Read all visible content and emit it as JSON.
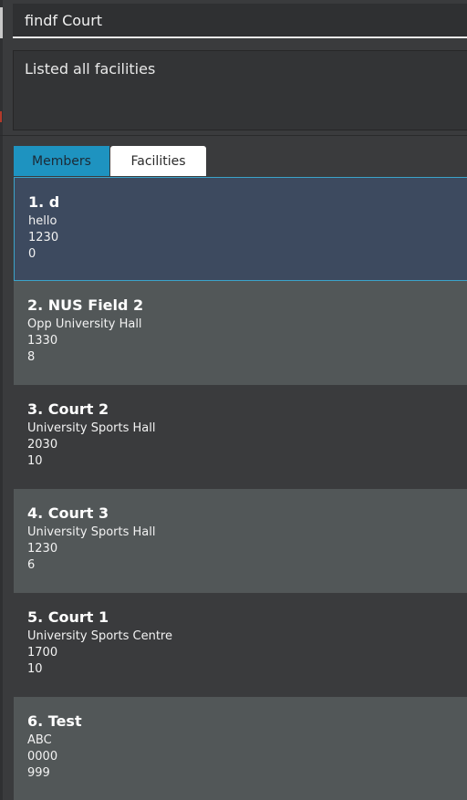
{
  "command": {
    "value": "findf Court"
  },
  "result": {
    "message": "Listed all facilities"
  },
  "tabs": [
    {
      "label": "Members"
    },
    {
      "label": "Facilities"
    }
  ],
  "facilities": [
    {
      "title": "1. d",
      "location": "hello",
      "time": "1230",
      "capacity": "0"
    },
    {
      "title": "2. NUS Field 2",
      "location": "Opp University Hall",
      "time": "1330",
      "capacity": "8"
    },
    {
      "title": "3. Court 2",
      "location": "University Sports Hall",
      "time": "2030",
      "capacity": "10"
    },
    {
      "title": "4. Court 3",
      "location": "University Sports Hall",
      "time": "1230",
      "capacity": "6"
    },
    {
      "title": "5. Court 1",
      "location": "University Sports Centre",
      "time": "1700",
      "capacity": "10"
    },
    {
      "title": "6. Test",
      "location": "ABC",
      "time": "0000",
      "capacity": "999"
    }
  ],
  "colors": {
    "tab_active": "#1e93c0",
    "selected_card": "#3d4a5f",
    "selected_border": "#3ba3c9",
    "card_dark": "#3a3b3d",
    "card_light": "#525758"
  }
}
